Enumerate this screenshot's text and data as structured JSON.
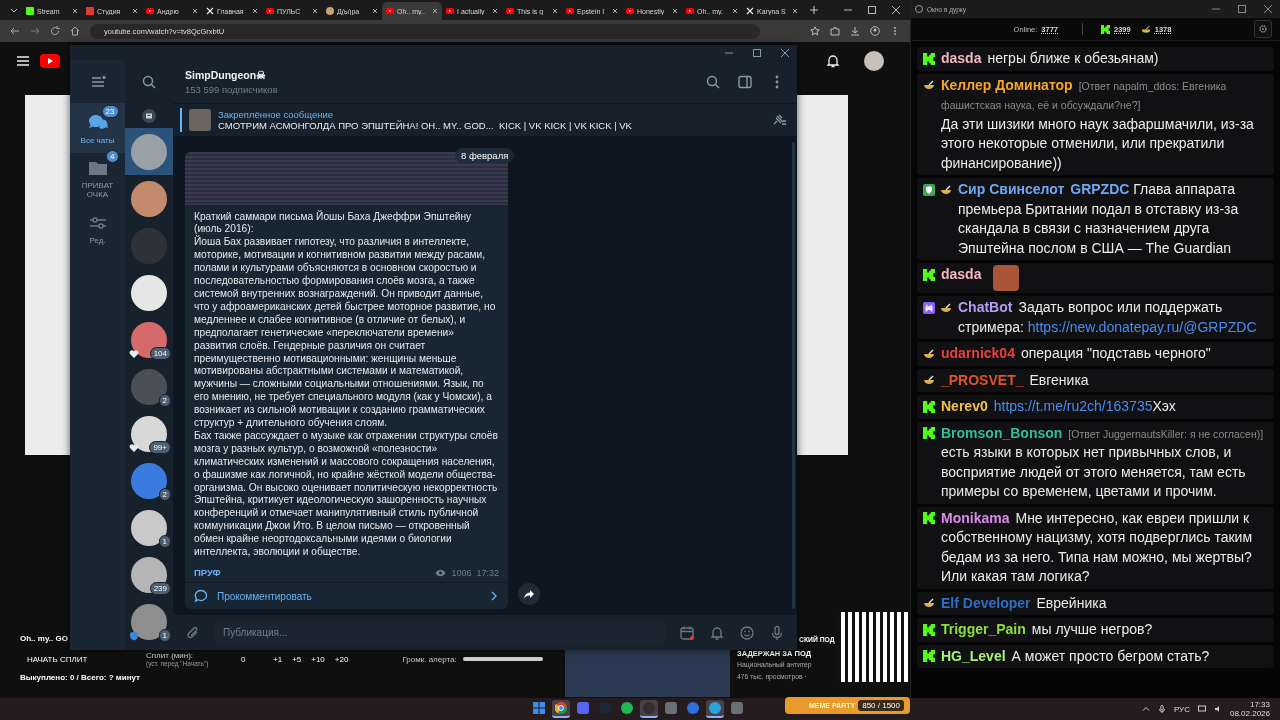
{
  "browser": {
    "tabs": [
      {
        "label": "Stream",
        "kind": "kick",
        "selected": false
      },
      {
        "label": "Студия",
        "kind": "studio",
        "selected": false
      },
      {
        "label": "Андрю",
        "kind": "video",
        "selected": false
      },
      {
        "label": "Главная",
        "kind": "x",
        "selected": false
      },
      {
        "label": "ПУЛЬС",
        "kind": "video",
        "selected": false
      },
      {
        "label": "Д(ы)ра",
        "kind": "avatar",
        "selected": false
      },
      {
        "label": "Oh.. my..",
        "kind": "video",
        "selected": true
      },
      {
        "label": "I actually",
        "kind": "video",
        "selected": false
      },
      {
        "label": "This is g",
        "kind": "video",
        "selected": false
      },
      {
        "label": "Epstein I",
        "kind": "video",
        "selected": false
      },
      {
        "label": "Honestly",
        "kind": "video",
        "selected": false
      },
      {
        "label": "Oh.. my.",
        "kind": "video",
        "selected": false
      },
      {
        "label": "Karyna S",
        "kind": "x",
        "selected": false
      }
    ],
    "address": "youtube.com/watch?v=tv8QcGrxbtU"
  },
  "stream_overlay": {
    "title": "Oh.. my.. GO",
    "start_button": "НАЧАТЬ СПЛИТ",
    "split_label": "Сплит (мин):",
    "split_hint": "(уст. перед \"Начать\")",
    "split_value": "0",
    "increments": [
      "+1",
      "+5",
      "+10",
      "+20"
    ],
    "volume_label": "Громк. алерта:",
    "volume": {
      "level": 1
    },
    "bought": "Выкуплено: 0 / Всего: ? минут"
  },
  "recommended": {
    "title_lines": [
      "СКИЙ ПОД",
      "ЗАДЕРЖАН ЗА ПОД"
    ],
    "channel": "Национальный антитер",
    "views": "476 тыс. просмотров ·"
  },
  "telegram": {
    "folders": [
      {
        "label": "Все чаты",
        "badge": "23",
        "kind": "chats",
        "selected": true
      },
      {
        "label": "ПРИВАТ ОЧКА",
        "badge": "4",
        "kind": "folder",
        "selected": false
      },
      {
        "label": "Ред.",
        "kind": "edit",
        "selected": false
      }
    ],
    "chats": [
      {
        "selected": true,
        "kind": "plain"
      },
      {
        "selected": false,
        "kind": "plain"
      },
      {
        "selected": false,
        "kind": "plain"
      },
      {
        "selected": false,
        "kind": "plain"
      },
      {
        "selected": false,
        "kind": "heart",
        "badge": "104"
      },
      {
        "selected": false,
        "kind": "plain",
        "badge": "2"
      },
      {
        "selected": false,
        "kind": "heart",
        "badge": "99+"
      },
      {
        "selected": false,
        "kind": "plain",
        "badge": "2"
      },
      {
        "selected": false,
        "kind": "plain",
        "badge": "1"
      },
      {
        "selected": false,
        "kind": "plain",
        "badge": "239"
      },
      {
        "selected": false,
        "kind": "shield",
        "badge": "1"
      }
    ],
    "channel": {
      "name": "SimpDungeon☠",
      "subscribers": "153 599 подписчиков"
    },
    "pinned": {
      "title": "Закреплённое сообщение",
      "text": "СМОТРИМ АСМОНГОЛДА ПРО ЭПШТЕЙНА! OH.. MY.. GOD...  KICK | VK KICK | VK KICK | VK"
    },
    "date": "8 февраля",
    "post": {
      "paragraphs": [
        "Краткий саммари письма Йошы Баха Джеффри Эпштейну (июль 2016):",
        "Йоша Бах развивает гипотезу, что различия в интеллекте, моторике, мотивации и когнитивном развитии между расами, полами и культурами объясняются в основном скоростью и последовательностью формирования слоёв мозга, а также системой внутренних вознаграждений. Он приводит данные, что у афроамериканских детей быстрее моторное развитие, но медленнее и слабее когнитивное (в отличие от белых), и предполагает генетические «переключатели времени» развития слоёв. Гендерные различия он считает преимущественно мотивационными: женщины меньше мотивированы абстрактными системами и математикой, мужчины — сложными социальными отношениями. Язык, по его мнению, не требует специального модуля (как у Чомски), а возникает из сильной мотивации к созданию грамматических структур + длительного обучения слоям.",
        "Бах также рассуждает о музыке как отражении структуры слоёв мозга у разных культур, о возможной «полезности» климатических изменений и массового сокращения населения, о фашизме как логичной, но крайне жёсткой модели общества-организма. Он высоко оценивает политическую некорректность Эпштейна, критикует идеологическую зашоренность научных конференций и отмечает манипулятивный стиль публичной коммуникации Джои Ито. В целом письмо — откровенный обмен крайне неортодоксальными идеями о биологии интеллекта, эволюции и обществе."
      ],
      "link": "ПРУФ",
      "views": "1006",
      "time": "17:32",
      "comment": "Прокомментировать"
    },
    "composer": {
      "placeholder": "Публикация..."
    }
  },
  "chat": {
    "window_title": "Окно в дурку",
    "online_label": "Online:",
    "online": "3777",
    "kick_count": "2399",
    "vk_count": "1378",
    "messages": [
      {
        "kind": "kick",
        "user": "dasda",
        "color": "#f4b6c2",
        "parts": [
          {
            "kind": "text",
            "text": "негры ближе к обезьянам)"
          }
        ]
      },
      {
        "kind": "vk",
        "user": "Келлер Доминатор",
        "color": "#f5a623",
        "reply": "[Ответ napalm_ddos: Евгеника фашистская наука, её и обсуждали?не?]",
        "parts": [
          {
            "kind": "text",
            "text": "Да эти шизики много наук зафаршмачили, из-за этого некоторые отменили, или прекратили финансирование))"
          }
        ]
      },
      {
        "kind": "vk",
        "badges": [
          {
            "kind": "mod"
          }
        ],
        "user": "Сир Свинселот",
        "color": "#6fa8f5",
        "parts": [
          {
            "kind": "mention",
            "text": "GRPZDC"
          },
          {
            "kind": "text",
            "text": " Глава аппарата премьера Британии подал в отставку из-за скандала в связи с назначением друга Эпштейна послом в США — The Guardian"
          }
        ]
      },
      {
        "kind": "kick",
        "user": "dasda",
        "color": "#f4b6c2",
        "parts": [
          {
            "kind": "emote"
          }
        ]
      },
      {
        "kind": "vk",
        "badges": [
          {
            "kind": "bot"
          }
        ],
        "user": "ChatBot",
        "color": "#b79cf5",
        "parts": [
          {
            "kind": "text",
            "text": "Задать вопрос или поддержать стримера: "
          },
          {
            "kind": "link",
            "text": "https://new.donatepay.ru/@GRPZDC"
          }
        ]
      },
      {
        "kind": "vk",
        "user": "udarnick04",
        "color": "#e8413c",
        "parts": [
          {
            "kind": "text",
            "text": "операция \"подставь черного\""
          }
        ]
      },
      {
        "kind": "vk",
        "user": "_PROSVET_",
        "color": "#e0532e",
        "parts": [
          {
            "kind": "text",
            "text": "Евгеника"
          }
        ]
      },
      {
        "kind": "kick",
        "user": "Nerev0",
        "color": "#f2c14e",
        "parts": [
          {
            "kind": "link",
            "text": "https://t.me/ru2ch/163735"
          },
          {
            "kind": "text",
            "text": "Хэх"
          }
        ]
      },
      {
        "kind": "kick",
        "user": "Bromson_Bonson",
        "color": "#2bbf9f",
        "reply": "[Ответ JuggernautsKiller: я не согласен)]",
        "parts": [
          {
            "kind": "text",
            "text": "есть языки в которых нет привычных слов, и восприятие людей от этого меняется, там есть примеры со временем, цветами и прочим."
          }
        ]
      },
      {
        "kind": "kick",
        "user": "Monikama",
        "color": "#d98be8",
        "parts": [
          {
            "kind": "text",
            "text": "Мне интересно, как евреи пришли к собственному нацизму, хотя подверглись таким бедам из за него. Типа нам можно, мы жертвы? Или какая там логика?"
          }
        ]
      },
      {
        "kind": "vk",
        "user": "Elf Developer",
        "color": "#2d6fc4",
        "parts": [
          {
            "kind": "text",
            "text": "Еврейника"
          }
        ]
      },
      {
        "kind": "kick",
        "user": "Trigger_Pain",
        "color": "#8be03c",
        "parts": [
          {
            "kind": "text",
            "text": "мы лучше негров?"
          }
        ]
      },
      {
        "kind": "kick",
        "user": "HG_Level",
        "color": "#a8f07a",
        "parts": [
          {
            "kind": "text",
            "text": "А может просто бегром стать?"
          }
        ]
      }
    ]
  },
  "taskbar": {
    "apps": [
      {
        "kind": "start",
        "selected": false
      },
      {
        "kind": "browser",
        "selected": true
      },
      {
        "kind": "chat",
        "selected": false
      },
      {
        "kind": "game",
        "selected": false
      },
      {
        "kind": "music",
        "selected": false
      },
      {
        "kind": "record",
        "selected": true
      },
      {
        "kind": "app",
        "selected": false
      },
      {
        "kind": "player",
        "selected": false
      },
      {
        "kind": "messenger",
        "selected": true
      },
      {
        "kind": "app",
        "selected": false
      }
    ],
    "language": "РУС",
    "time": "17:33",
    "date": "08.02.2026"
  },
  "meme_party": {
    "title": "MEME PARTY",
    "progress": "850 / 1500"
  }
}
